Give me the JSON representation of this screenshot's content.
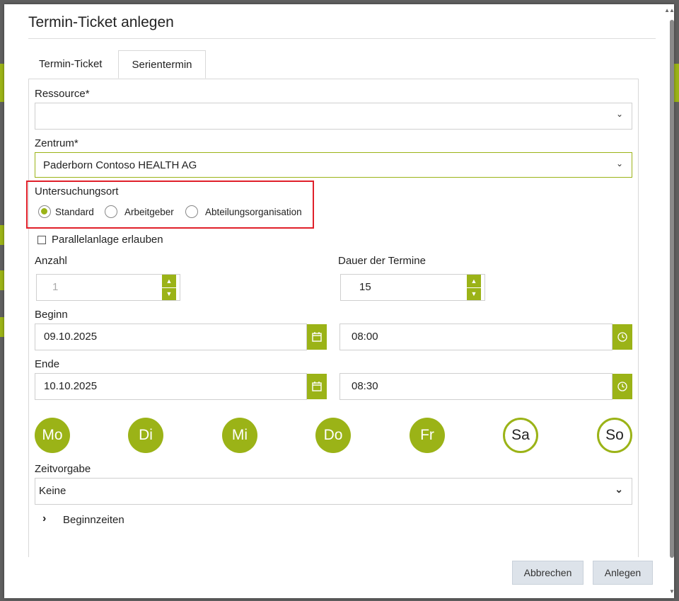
{
  "dialog": {
    "title": "Termin-Ticket anlegen",
    "tabs": [
      {
        "label": "Termin-Ticket",
        "active": false
      },
      {
        "label": "Serientermin",
        "active": true
      }
    ]
  },
  "form": {
    "ressource": {
      "label": "Ressource*",
      "value": ""
    },
    "zentrum": {
      "label": "Zentrum*",
      "value": "Paderborn Contoso HEALTH AG"
    },
    "untersuchungsort": {
      "label": "Untersuchungsort",
      "options": [
        {
          "label": "Standard",
          "selected": true
        },
        {
          "label": "Arbeitgeber",
          "selected": false
        },
        {
          "label": "Abteilungsorganisation",
          "selected": false
        }
      ]
    },
    "parallelanlage": {
      "label": "Parallelanlage erlauben",
      "checked": false
    },
    "anzahl": {
      "label": "Anzahl",
      "value": "1"
    },
    "dauer": {
      "label": "Dauer der Termine",
      "value": "15"
    },
    "beginn": {
      "label": "Beginn",
      "date": "09.10.2025",
      "time": "08:00"
    },
    "ende": {
      "label": "Ende",
      "date": "10.10.2025",
      "time": "08:30"
    },
    "weekdays": [
      {
        "label": "Mo",
        "active": true
      },
      {
        "label": "Di",
        "active": true
      },
      {
        "label": "Mi",
        "active": true
      },
      {
        "label": "Do",
        "active": true
      },
      {
        "label": "Fr",
        "active": true
      },
      {
        "label": "Sa",
        "active": false
      },
      {
        "label": "So",
        "active": false
      }
    ],
    "zeitvorgabe": {
      "label": "Zeitvorgabe",
      "value": "Keine"
    },
    "beginnzeiten": {
      "label": "Beginnzeiten"
    }
  },
  "buttons": {
    "cancel": "Abbrechen",
    "create": "Anlegen"
  },
  "colors": {
    "accent": "#9bb317",
    "highlight_box": "#e0202a"
  },
  "icons": {
    "dropdown": "chevron-down-icon",
    "calendar": "calendar-icon",
    "clock": "clock-icon",
    "expand": "chevron-right-icon"
  }
}
